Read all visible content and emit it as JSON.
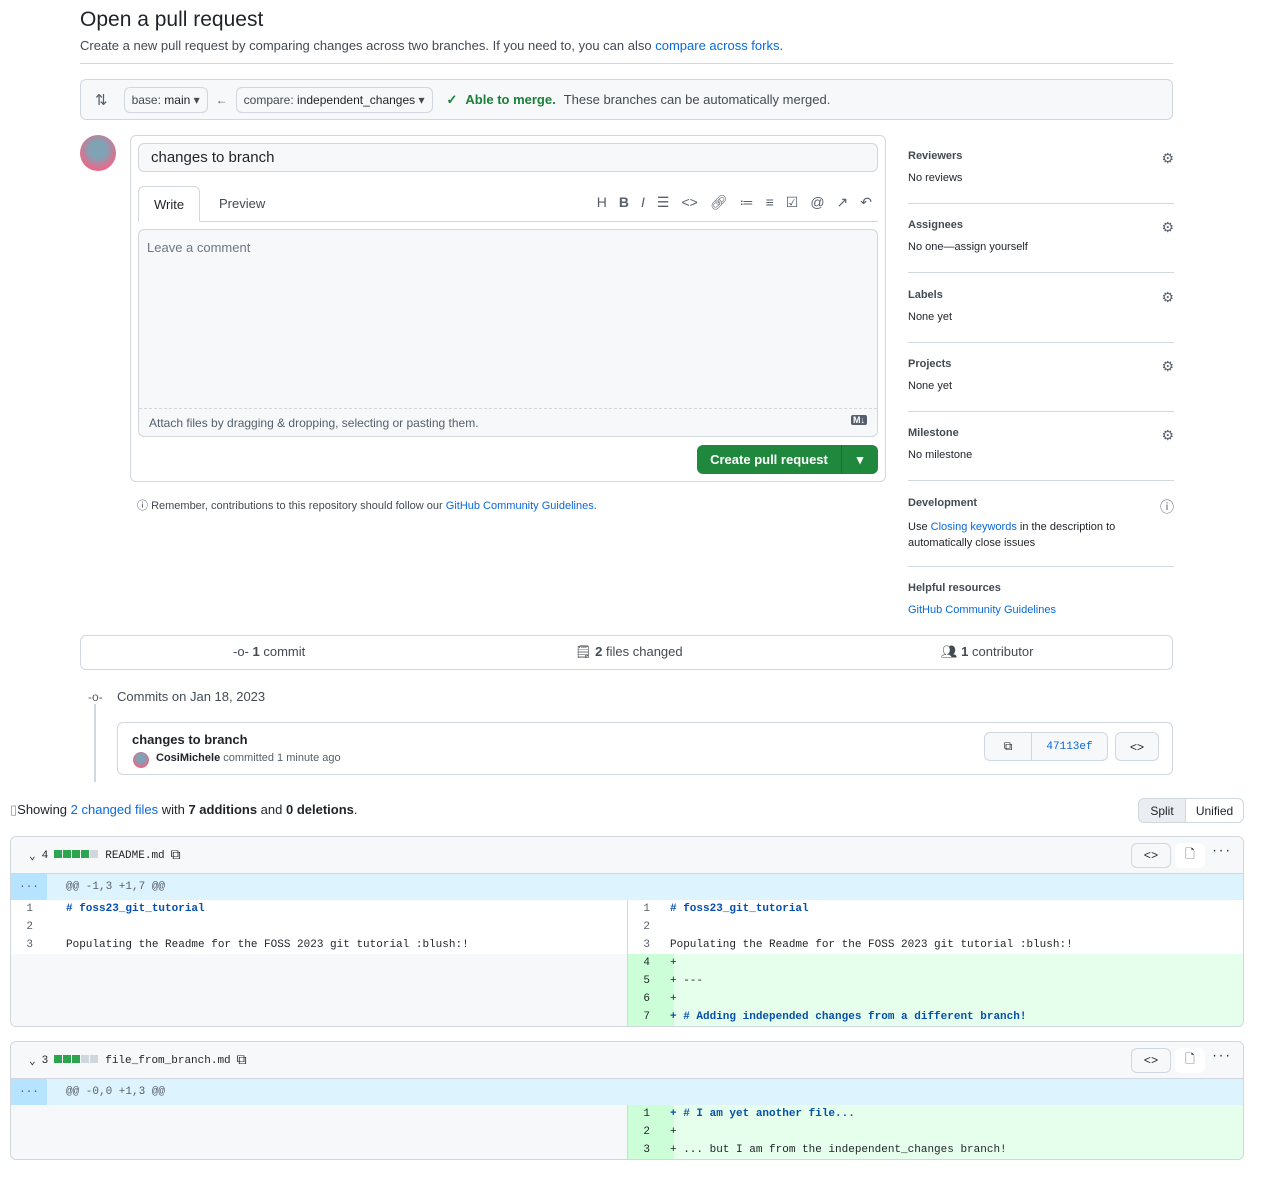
{
  "header": {
    "title": "Open a pull request",
    "subtitle": "Create a new pull request by comparing changes across two branches. If you need to, you can also ",
    "subtitle_link": "compare across forks",
    "subtitle_end": "."
  },
  "range": {
    "base_label": "base:",
    "base": "main",
    "compare_label": "compare:",
    "compare": "independent_changes",
    "merge_status": "Able to merge.",
    "merge_msg": "These branches can be automatically merged.",
    "status_color": "#1a7f37"
  },
  "form": {
    "title_value": "changes to branch",
    "tabs": [
      "Write",
      "Preview"
    ],
    "toolbar_icons": [
      "heading-icon",
      "bold-icon",
      "italic-icon",
      "quote-icon",
      "code-icon",
      "link-icon",
      "unordered-list-icon",
      "ordered-list-icon",
      "task-list-icon",
      "mention-icon",
      "reference-icon",
      "undo-icon"
    ],
    "comment_placeholder": "Leave a comment",
    "attach_text": "Attach files by dragging & dropping, selecting or pasting them.",
    "create_button": "Create pull request",
    "note_pre": "Remember, contributions to this repository should follow our ",
    "note_link": "GitHub Community Guidelines",
    "note_end": "."
  },
  "sidebar": {
    "reviewers": {
      "h": "Reviewers",
      "v": "No reviews"
    },
    "assignees": {
      "h": "Assignees",
      "v": "No one—assign yourself"
    },
    "labels": {
      "h": "Labels",
      "v": "None yet"
    },
    "projects": {
      "h": "Projects",
      "v": "None yet"
    },
    "milestone": {
      "h": "Milestone",
      "v": "No milestone"
    },
    "development": {
      "h": "Development",
      "pre": "Use ",
      "link": "Closing keywords",
      "post": " in the description to automatically close issues"
    },
    "helpful": {
      "h": "Helpful resources",
      "link": "GitHub Community Guidelines"
    }
  },
  "stats": {
    "commits_n": "1",
    "commits": "commit",
    "files_n": "2",
    "files": "files changed",
    "contrib_n": "1",
    "contrib": "contributor"
  },
  "commits": {
    "date": "Commits on Jan 18, 2023",
    "message": "changes to branch",
    "author": "CosiMichele",
    "meta": "committed 1 minute ago",
    "sha": "47113ef"
  },
  "diff": {
    "showing": "Showing ",
    "files_link": "2 changed files",
    "with": " with ",
    "additions": "7 additions",
    "and": " and ",
    "deletions": "0 deletions",
    "end": ".",
    "split": "Split",
    "unified": "Unified",
    "files": [
      {
        "count": "4",
        "name": "README.md",
        "hunk": "@@ -1,3 +1,7 @@",
        "left": [
          [
            "1",
            "# foss23_git_tutorial"
          ],
          [
            "2",
            ""
          ],
          [
            "3",
            "Populating the Readme for the FOSS 2023 git tutorial :blush:!"
          ]
        ],
        "right": [
          [
            "1",
            "# foss23_git_tutorial"
          ],
          [
            "2",
            ""
          ],
          [
            "3",
            "Populating the Readme for the FOSS 2023 git tutorial :blush:!"
          ],
          [
            "4",
            "+ "
          ],
          [
            "5",
            "+ ---"
          ],
          [
            "6",
            "+ "
          ],
          [
            "7",
            "+ # Adding independed changes from a different branch!"
          ]
        ]
      },
      {
        "count": "3",
        "name": "file_from_branch.md",
        "hunk": "@@ -0,0 +1,3 @@",
        "left": [],
        "right": [
          [
            "1",
            "+ # I am yet another file..."
          ],
          [
            "2",
            "+ "
          ],
          [
            "3",
            "+ ... but I am from the independent_changes branch!"
          ]
        ]
      }
    ]
  }
}
